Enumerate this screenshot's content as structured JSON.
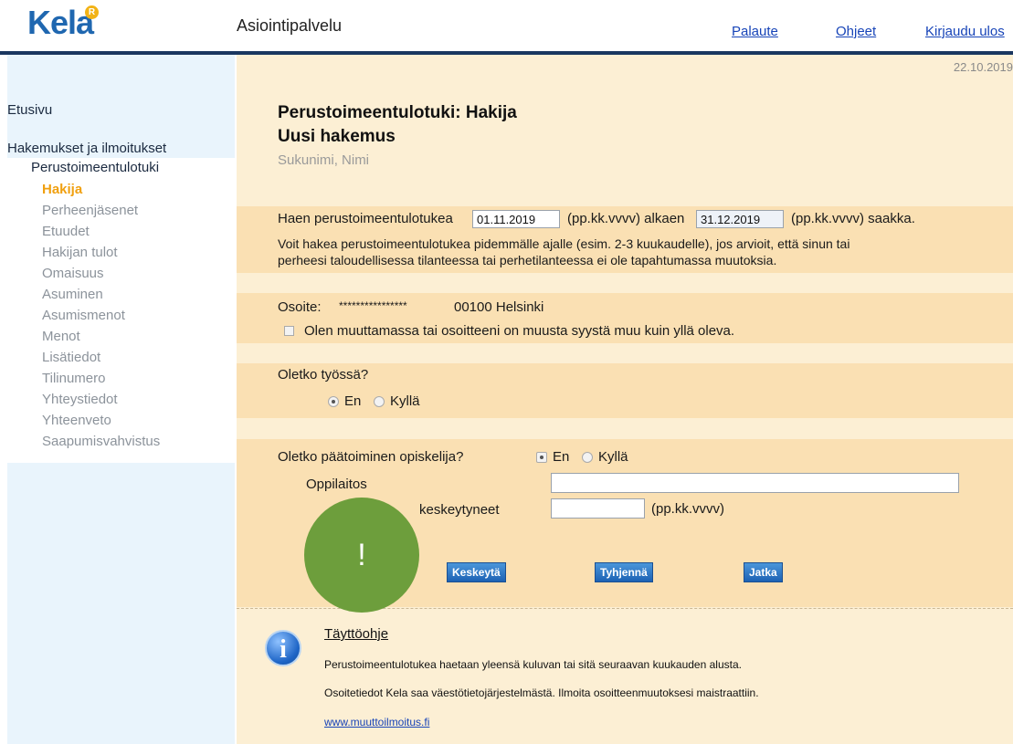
{
  "header": {
    "logo_text": "Kela",
    "logo_mark": "R",
    "app_title": "Asiointipalvelu",
    "links": [
      "Palaute",
      "Ohjeet",
      "Kirjaudu ulos"
    ]
  },
  "date": "22.10.2019",
  "sidebar": {
    "home": "Etusivu",
    "group_title": "Hakemukset ja ilmoitukset",
    "sub_title": "Perustoimeentulotuki",
    "items": [
      "Hakija",
      "Perheenjäsenet",
      "Etuudet",
      "Hakijan tulot",
      "Omaisuus",
      "Asuminen",
      "Asumismenot",
      "Menot",
      "Lisätiedot",
      "Tilinumero",
      "Yhteystiedot",
      "Yhteenveto",
      "Saapumisvahvistus"
    ],
    "active_item": "Hakija"
  },
  "form": {
    "title": "Perustoimeentulotuki: Hakija",
    "subtitle": "Uusi hakemus",
    "applicant": "Sukunimi, Nimi",
    "period": {
      "prefix": "Haen perustoimeentulotukea",
      "start_value": "01.11.2019",
      "start_suffix": "(pp.kk.vvvv) alkaen",
      "end_value": "31.12.2019",
      "end_suffix": "(pp.kk.vvvv) saakka.",
      "note_line1": "Voit hakea perustoimeentulotukea pidemmälle ajalle (esim. 2-3 kuukaudelle), jos arvioit, että sinun tai",
      "note_line2": "perheesi taloudellisessa tilanteessa tai perhetilanteessa ei ole tapahtumassa muutoksia."
    },
    "address": {
      "label": "Osoite:",
      "masked": "****************",
      "postal": "00100 Helsinki",
      "moving_checkbox": "Olen muuttamassa tai osoitteeni on muusta syystä muu kuin yllä oleva."
    },
    "working": {
      "question": "Oletko työssä?",
      "no": "En",
      "yes": "Kyllä"
    },
    "student": {
      "question": "Oletko päätoiminen opiskelija?",
      "no": "En",
      "yes": "Kyllä",
      "institution_label": "Oppilaitos",
      "interrupted_label": "keskeytyneet",
      "date_format": "(pp.kk.vvvv)"
    },
    "buttons": {
      "cancel": "Keskeytä",
      "clear": "Tyhjennä",
      "continue": "Jatka"
    },
    "alert_symbol": "!"
  },
  "help": {
    "title": "Täyttöohje",
    "line1": "Perustoimeentulotukea haetaan yleensä kuluvan tai sitä seuraavan kuukauden alusta.",
    "line2": "Osoitetiedot Kela saa väestötietojärjestelmästä. Ilmoita osoitteenmuutoksesi maistraattiin.",
    "link": "www.muuttoilmoitus.fi"
  },
  "colors": {
    "brand_blue": "#1f67b0",
    "main_bg": "#fcefd4",
    "band_bg": "#fae0b3",
    "sidebar_bg": "#e9f4fc",
    "active_orange": "#f0a010",
    "alert_green": "#6d9e3c"
  },
  "icons": [
    "logo-mark-icon",
    "info-icon",
    "checkbox-icon",
    "radio-icon"
  ]
}
